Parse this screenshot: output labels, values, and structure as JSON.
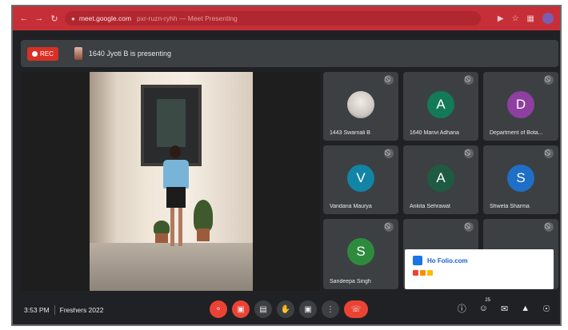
{
  "browser": {
    "url": "meet.google.com",
    "url_suffix": "pxr-ruzn-ryhh — Meet Presenting",
    "back_icon": "arrow-left-icon",
    "forward_icon": "arrow-right-icon",
    "reload_icon": "reload-icon"
  },
  "banner": {
    "rec_label": "REC",
    "presenting_text": "1640 Jyoti B is presenting"
  },
  "participants": [
    {
      "name": "1443 Swarnali B",
      "initial": "",
      "color": "#9aa0a6",
      "photo": true
    },
    {
      "name": "1640 Manvi Adhana",
      "initial": "A",
      "color": "#137a57"
    },
    {
      "name": "Department of Bota...",
      "initial": "D",
      "color": "#8e3fa0"
    },
    {
      "name": "Vandana Maurya",
      "initial": "V",
      "color": "#1285a6"
    },
    {
      "name": "Ankita Sehrawat",
      "initial": "A",
      "color": "#1f5b42"
    },
    {
      "name": "Shweta Sharma",
      "initial": "S",
      "color": "#1f6fc6"
    },
    {
      "name": "Sandeepa Singh",
      "initial": "S",
      "color": "#2e8b3e"
    }
  ],
  "popup": {
    "text": "Ho Folio.com"
  },
  "bottom": {
    "time": "3:53 PM",
    "meeting": "Freshers 2022",
    "participant_count": "25"
  },
  "colors": {
    "browser_bar": "#c62f37",
    "background": "#202124",
    "tile": "#3c4043",
    "danger": "#ea4335"
  }
}
